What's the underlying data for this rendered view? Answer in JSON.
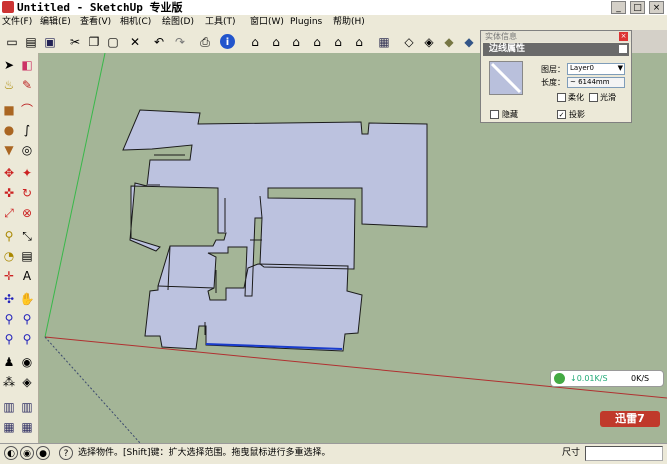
{
  "window": {
    "title": "Untitled - SketchUp 专业版"
  },
  "window_buttons": {
    "minimize": "_",
    "maximize": "□",
    "close": "×"
  },
  "menu": [
    {
      "label": "文件(F)"
    },
    {
      "label": "编辑(E)"
    },
    {
      "label": "查看(V)"
    },
    {
      "label": "相机(C)"
    },
    {
      "label": "绘图(D)"
    },
    {
      "label": "工具(T)"
    },
    {
      "label": "窗口(W)"
    },
    {
      "label": "Plugins"
    },
    {
      "label": "帮助(H)"
    }
  ],
  "toolbar_icons": [
    "new-file",
    "open-folder",
    "save",
    "cut",
    "copy",
    "paste",
    "delete",
    "undo",
    "redo",
    "print",
    "model-info",
    "home-iso",
    "top-view",
    "front-view",
    "right-view",
    "back-view",
    "left-view",
    "xray",
    "wireframe",
    "hidden-line",
    "shaded",
    "shaded-textured",
    "monochrome"
  ],
  "left_tools": [
    "select",
    "eraser",
    "paint-bucket",
    "pencil-line",
    "rectangle",
    "arc",
    "circle",
    "freehand",
    "polygon",
    "offset",
    "push-pull",
    "follow-me",
    "move",
    "rotate",
    "scale",
    "intersect",
    "tape-measure",
    "dimension",
    "protractor",
    "text",
    "axes",
    "3d-text",
    "orbit",
    "pan",
    "zoom",
    "zoom-window",
    "zoom-extents",
    "previous-view",
    "walk",
    "look-around",
    "position-camera",
    "section-plane"
  ],
  "entity_panel": {
    "window_title": "实体信息",
    "header": "边线属性",
    "layer_label": "图层：",
    "layer_value": "Layer0",
    "length_label": "长度：",
    "length_value": "~ 6144mm",
    "soften_label": "柔化",
    "smooth_label": "光滑",
    "hidden_label": "隐藏",
    "cast_shadow_label": "投影",
    "cast_shadow_checked": true
  },
  "net_monitor": {
    "download": "0.01K/S",
    "upload": "0K/S"
  },
  "xunlei": {
    "label": "迅雷7"
  },
  "status": {
    "hint": "选择物件。[Shift]键：扩大选择范围。拖曳鼠标进行多重选择。",
    "measure_label": "尺寸",
    "measure_value": ""
  },
  "colors": {
    "viewport_bg": "#a4b597",
    "floor_plan_fill": "#bcc2df",
    "axis_red": "#b03030",
    "axis_green": "#39b84a",
    "selected_edge": "#1a3ccc"
  }
}
